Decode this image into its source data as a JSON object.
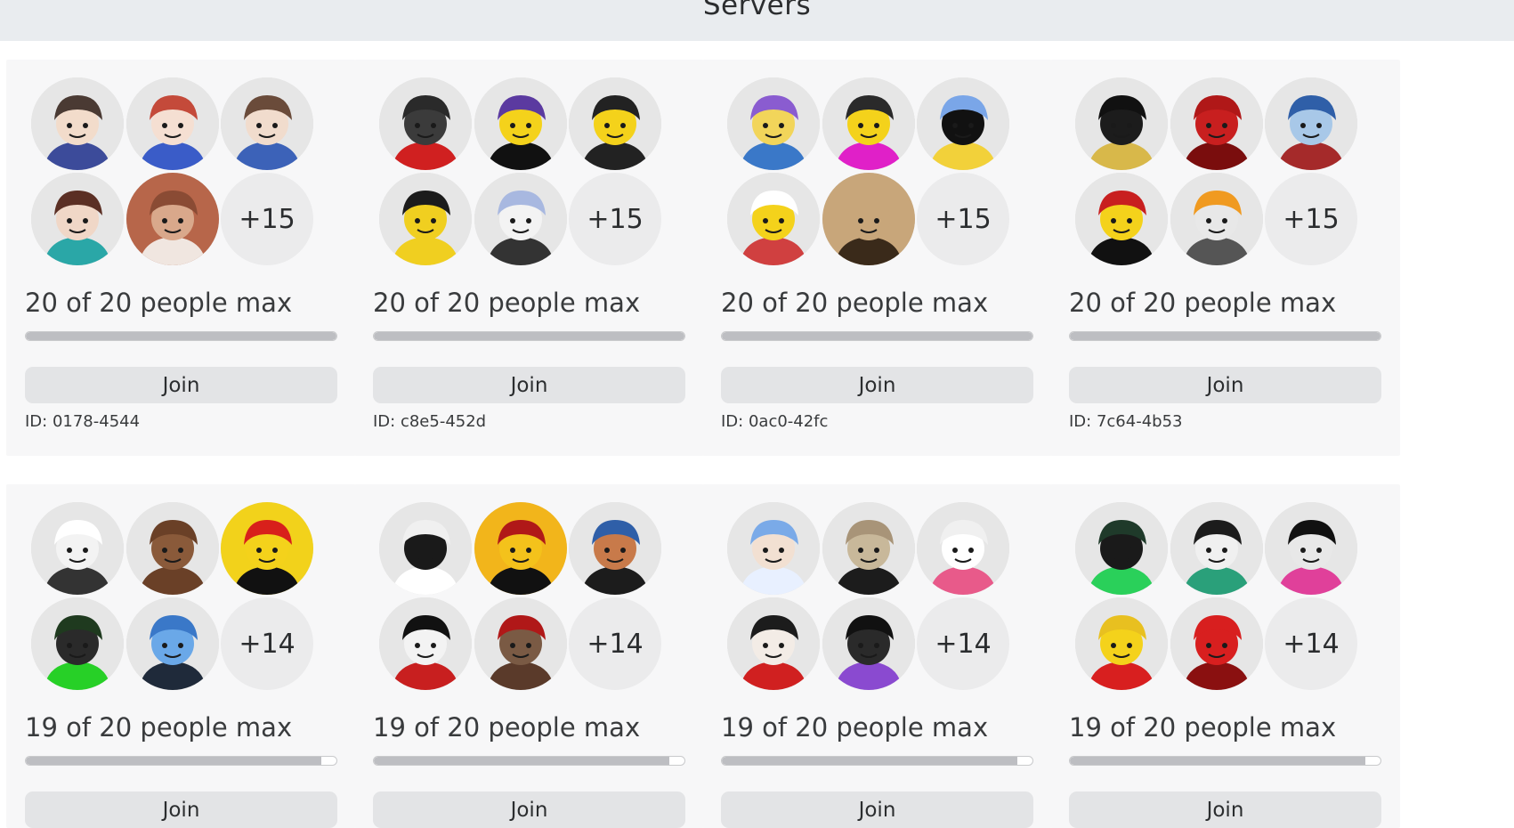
{
  "page": {
    "title": "Servers"
  },
  "servers": [
    {
      "count_label": "20 of 20 people max",
      "players": 20,
      "max": 20,
      "extra_label": "+15",
      "join_label": "Join",
      "id_label": "ID: 0178-4544",
      "avatars": [
        {
          "name": "avatar-dark-hair-blue-hat",
          "bg": "#e6e6e6",
          "skin": "#f2dccb",
          "hair": "#4a3a33",
          "accent": "#3c4b9a"
        },
        {
          "name": "avatar-red-hair-anime",
          "bg": "#e6e6e6",
          "skin": "#f5dfd2",
          "hair": "#c44a3a",
          "accent": "#3a5cc8"
        },
        {
          "name": "avatar-brown-hair-closeup",
          "bg": "#e6e6e6",
          "skin": "#f1dccd",
          "hair": "#6a4b3a",
          "accent": "#3c62b8"
        },
        {
          "name": "avatar-brown-bob-hair",
          "bg": "#e6e6e6",
          "skin": "#f0d7c7",
          "hair": "#5b2f24",
          "accent": "#2aa7a7"
        },
        {
          "name": "avatar-bandaged-face",
          "bg": "#b7664a",
          "skin": "#d9a88b",
          "hair": "#8a4b34",
          "accent": "#f0e6e0"
        }
      ]
    },
    {
      "count_label": "20 of 20 people max",
      "players": 20,
      "max": 20,
      "extra_label": "+15",
      "join_label": "Join",
      "id_label": "ID: c8e5-452d",
      "avatars": [
        {
          "name": "avatar-robot-red-eyes",
          "bg": "#e6e6e6",
          "skin": "#3b3b3b",
          "hair": "#2a2a2a",
          "accent": "#d02020"
        },
        {
          "name": "avatar-purple-cap-sunglasses",
          "bg": "#e6e6e6",
          "skin": "#f4d21b",
          "hair": "#5b3aa0",
          "accent": "#111111"
        },
        {
          "name": "avatar-black-fedora",
          "bg": "#e6e6e6",
          "skin": "#f4d21b",
          "hair": "#222222",
          "accent": "#222222"
        },
        {
          "name": "avatar-black-bunny-ears",
          "bg": "#e6e6e6",
          "skin": "#f0cf20",
          "hair": "#1c1c1c",
          "accent": "#f0cf20"
        },
        {
          "name": "avatar-white-blue-hair",
          "bg": "#e6e6e6",
          "skin": "#f3f3f3",
          "hair": "#a8b8e0",
          "accent": "#333333"
        }
      ]
    },
    {
      "count_label": "20 of 20 people max",
      "players": 20,
      "max": 20,
      "extra_label": "+15",
      "join_label": "Join",
      "id_label": "ID: 0ac0-42fc",
      "avatars": [
        {
          "name": "avatar-party-hat",
          "bg": "#e6e6e6",
          "skin": "#f2d55a",
          "hair": "#8a5cd0",
          "accent": "#3a78c8"
        },
        {
          "name": "avatar-magenta-shirt",
          "bg": "#e6e6e6",
          "skin": "#f4d21b",
          "hair": "#2a2a2a",
          "accent": "#e020c8"
        },
        {
          "name": "avatar-black-block-blue-spikes",
          "bg": "#e6e6e6",
          "skin": "#111111",
          "hair": "#7aa6e8",
          "accent": "#f2d13a"
        },
        {
          "name": "avatar-white-hat-blonde",
          "bg": "#e6e6e6",
          "skin": "#f4d21b",
          "hair": "#ffffff",
          "accent": "#d04040"
        },
        {
          "name": "avatar-smiley-face",
          "bg": "#c8a67a",
          "skin": "#c8a67a",
          "hair": "#c8a67a",
          "accent": "#3a2a1a"
        }
      ]
    },
    {
      "count_label": "20 of 20 people max",
      "players": 20,
      "max": 20,
      "extra_label": "+15",
      "join_label": "Join",
      "id_label": "ID: 7c64-4b53",
      "avatars": [
        {
          "name": "avatar-black-bunny-suit",
          "bg": "#e6e6e6",
          "skin": "#1c1c1c",
          "hair": "#111111",
          "accent": "#d8b84a"
        },
        {
          "name": "avatar-red-horns",
          "bg": "#e6e6e6",
          "skin": "#c81f1f",
          "hair": "#b01818",
          "accent": "#7a0d0d"
        },
        {
          "name": "avatar-blue-helmet",
          "bg": "#e6e6e6",
          "skin": "#a8c8e8",
          "hair": "#2f5fa8",
          "accent": "#a52a2a"
        },
        {
          "name": "avatar-red-horned-hat",
          "bg": "#e6e6e6",
          "skin": "#f4d21b",
          "hair": "#c81f1f",
          "accent": "#111111"
        },
        {
          "name": "avatar-orange-hardhat",
          "bg": "#e6e6e6",
          "skin": "#e8e8e8",
          "hair": "#f09a20",
          "accent": "#555555"
        }
      ]
    },
    {
      "count_label": "19 of 20 people max",
      "players": 19,
      "max": 20,
      "extra_label": "+14",
      "join_label": "Join",
      "id_label": "",
      "avatars": [
        {
          "name": "avatar-white-hat-its-wrong",
          "bg": "#e6e6e6",
          "skin": "#f3f3f3",
          "hair": "#ffffff",
          "accent": "#333333"
        },
        {
          "name": "avatar-brown-blocky",
          "bg": "#e6e6e6",
          "skin": "#8a5a3a",
          "hair": "#6a4027",
          "accent": "#6a4027"
        },
        {
          "name": "avatar-roblox-cap-smile",
          "bg": "#f2d21b",
          "skin": "#f4d21b",
          "hair": "#d8201b",
          "accent": "#111111"
        },
        {
          "name": "avatar-green-shadow",
          "bg": "#e6e6e6",
          "skin": "#2a2a2a",
          "hair": "#1f3a1f",
          "accent": "#27d027"
        },
        {
          "name": "avatar-blue-blocky",
          "bg": "#e6e6e6",
          "skin": "#6aa8e8",
          "hair": "#3a78c8",
          "accent": "#1f2a3a"
        }
      ]
    },
    {
      "count_label": "19 of 20 people max",
      "players": 19,
      "max": 20,
      "extra_label": "+14",
      "join_label": "Join",
      "id_label": "",
      "avatars": [
        {
          "name": "avatar-white-spiky-grin",
          "bg": "#e6e6e6",
          "skin": "#1a1a1a",
          "hair": "#f0f0f0",
          "accent": "#ffffff"
        },
        {
          "name": "avatar-gold-helmet",
          "bg": "#f2b51b",
          "skin": "#f4c21b",
          "hair": "#b01818",
          "accent": "#111111"
        },
        {
          "name": "avatar-small-blue-hat",
          "bg": "#e6e6e6",
          "skin": "#c87a4a",
          "hair": "#2f5fa8",
          "accent": "#1c1c1c"
        },
        {
          "name": "avatar-black-messy-hair",
          "bg": "#e6e6e6",
          "skin": "#f3f3f3",
          "hair": "#111111",
          "accent": "#c81f1f"
        },
        {
          "name": "avatar-seal-mask",
          "bg": "#e6e6e6",
          "skin": "#7a5a44",
          "hair": "#b01818",
          "accent": "#5a3a2a"
        }
      ]
    },
    {
      "count_label": "19 of 20 people max",
      "players": 19,
      "max": 20,
      "extra_label": "+14",
      "join_label": "Join",
      "id_label": "",
      "avatars": [
        {
          "name": "avatar-ice-crown",
          "bg": "#e6e6e6",
          "skin": "#f2e0d2",
          "hair": "#7aaae8",
          "accent": "#e8f0ff"
        },
        {
          "name": "avatar-tan-ninja",
          "bg": "#e6e6e6",
          "skin": "#c8b89a",
          "hair": "#a89478",
          "accent": "#1c1c1c"
        },
        {
          "name": "avatar-white-pink-headphones",
          "bg": "#e6e6e6",
          "skin": "#ffffff",
          "hair": "#f0f0f0",
          "accent": "#e85a8a"
        },
        {
          "name": "avatar-black-curly-hair",
          "bg": "#e6e6e6",
          "skin": "#f3ece6",
          "hair": "#1c1c1c",
          "accent": "#d02020"
        },
        {
          "name": "avatar-dark-purple-cat",
          "bg": "#e6e6e6",
          "skin": "#2a2a2a",
          "hair": "#111111",
          "accent": "#8a4ad0"
        }
      ]
    },
    {
      "count_label": "19 of 20 people max",
      "players": 19,
      "max": 20,
      "extra_label": "+14",
      "join_label": "Join",
      "id_label": "",
      "avatars": [
        {
          "name": "avatar-green-masked",
          "bg": "#e6e6e6",
          "skin": "#1a1a1a",
          "hair": "#1f3a2a",
          "accent": "#2ad05a"
        },
        {
          "name": "avatar-white-skull-mask",
          "bg": "#e6e6e6",
          "skin": "#f0f0f0",
          "hair": "#1c1c1c",
          "accent": "#2aa07a"
        },
        {
          "name": "avatar-pink-top-hat",
          "bg": "#e6e6e6",
          "skin": "#e8e8e8",
          "hair": "#111111",
          "accent": "#e0409a"
        },
        {
          "name": "avatar-red-shirt-blonde",
          "bg": "#e6e6e6",
          "skin": "#f4d21b",
          "hair": "#e8c020",
          "accent": "#d81f1f"
        },
        {
          "name": "avatar-red-shirt-text",
          "bg": "#e6e6e6",
          "skin": "#d81f1f",
          "hair": "#d81f1f",
          "accent": "#8a1010"
        }
      ]
    }
  ]
}
